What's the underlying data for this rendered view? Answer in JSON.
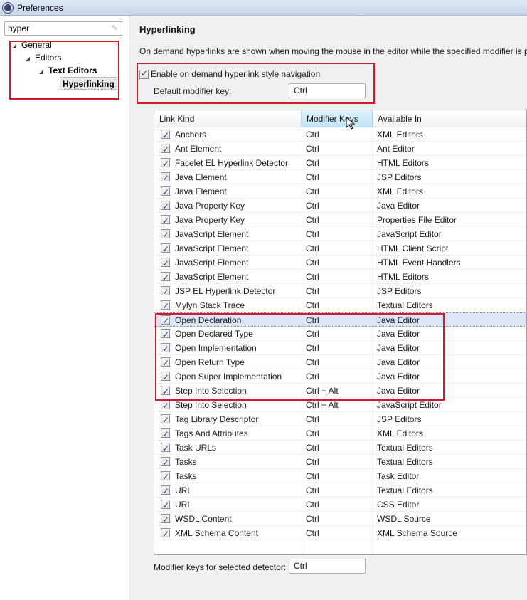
{
  "window": {
    "title": "Preferences"
  },
  "filter": {
    "value": "hyper"
  },
  "tree": {
    "general": "General",
    "editors": "Editors",
    "text_editors": "Text Editors",
    "hyperlinking": "Hyperlinking"
  },
  "page": {
    "title": "Hyperlinking",
    "description": "On demand hyperlinks are shown when moving the mouse in the editor while the specified modifier is p",
    "enable_label": "Enable on demand hyperlink style navigation",
    "enable_checked": true,
    "default_modifier_label": "Default modifier key:",
    "default_modifier_value": "Ctrl",
    "selected_modifier_label": "Modifier keys for selected detector:",
    "selected_modifier_value": "Ctrl"
  },
  "table": {
    "headers": [
      "Link Kind",
      "Modifier Keys",
      "Available In"
    ],
    "rows": [
      {
        "kind": "Anchors",
        "mod": "Ctrl",
        "avail": "XML Editors",
        "checked": true
      },
      {
        "kind": "Ant Element",
        "mod": "Ctrl",
        "avail": "Ant Editor",
        "checked": true
      },
      {
        "kind": "Facelet EL Hyperlink Detector",
        "mod": "Ctrl",
        "avail": "HTML Editors",
        "checked": true
      },
      {
        "kind": "Java Element",
        "mod": "Ctrl",
        "avail": "JSP Editors",
        "checked": true
      },
      {
        "kind": "Java Element",
        "mod": "Ctrl",
        "avail": "XML Editors",
        "checked": true
      },
      {
        "kind": "Java Property Key",
        "mod": "Ctrl",
        "avail": "Java Editor",
        "checked": true
      },
      {
        "kind": "Java Property Key",
        "mod": "Ctrl",
        "avail": "Properties File Editor",
        "checked": true
      },
      {
        "kind": "JavaScript Element",
        "mod": "Ctrl",
        "avail": "JavaScript Editor",
        "checked": true
      },
      {
        "kind": "JavaScript Element",
        "mod": "Ctrl",
        "avail": "HTML Client Script",
        "checked": true
      },
      {
        "kind": "JavaScript Element",
        "mod": "Ctrl",
        "avail": "HTML Event Handlers",
        "checked": true
      },
      {
        "kind": "JavaScript Element",
        "mod": "Ctrl",
        "avail": "HTML Editors",
        "checked": true
      },
      {
        "kind": "JSP EL Hyperlink Detector",
        "mod": "Ctrl",
        "avail": "JSP Editors",
        "checked": true
      },
      {
        "kind": "Mylyn Stack Trace",
        "mod": "Ctrl",
        "avail": "Textual Editors",
        "checked": true
      },
      {
        "kind": "Open Declaration",
        "mod": "Ctrl",
        "avail": "Java Editor",
        "checked": true
      },
      {
        "kind": "Open Declared Type",
        "mod": "Ctrl",
        "avail": "Java Editor",
        "checked": true
      },
      {
        "kind": "Open Implementation",
        "mod": "Ctrl",
        "avail": "Java Editor",
        "checked": true
      },
      {
        "kind": "Open Return Type",
        "mod": "Ctrl",
        "avail": "Java Editor",
        "checked": true
      },
      {
        "kind": "Open Super Implementation",
        "mod": "Ctrl",
        "avail": "Java Editor",
        "checked": true
      },
      {
        "kind": "Step Into Selection",
        "mod": "Ctrl + Alt",
        "avail": "Java Editor",
        "checked": true
      },
      {
        "kind": "Step Into Selection",
        "mod": "Ctrl + Alt",
        "avail": "JavaScript Editor",
        "checked": true
      },
      {
        "kind": "Tag Library Descriptor",
        "mod": "Ctrl",
        "avail": "JSP Editors",
        "checked": true
      },
      {
        "kind": "Tags And Attributes",
        "mod": "Ctrl",
        "avail": "XML Editors",
        "checked": true
      },
      {
        "kind": "Task URLs",
        "mod": "Ctrl",
        "avail": "Textual Editors",
        "checked": true
      },
      {
        "kind": "Tasks",
        "mod": "Ctrl",
        "avail": "Textual Editors",
        "checked": true
      },
      {
        "kind": "Tasks",
        "mod": "Ctrl",
        "avail": "Task Editor",
        "checked": true
      },
      {
        "kind": "URL",
        "mod": "Ctrl",
        "avail": "Textual Editors",
        "checked": true
      },
      {
        "kind": "URL",
        "mod": "Ctrl",
        "avail": "CSS Editor",
        "checked": true
      },
      {
        "kind": "WSDL Content",
        "mod": "Ctrl",
        "avail": "WSDL Source",
        "checked": true
      },
      {
        "kind": "XML Schema Content",
        "mod": "Ctrl",
        "avail": "XML Schema Source",
        "checked": true
      }
    ],
    "selected_row": 13
  },
  "colors": {
    "annotation": "#d21a2b",
    "selection": "#dbe7f7"
  }
}
